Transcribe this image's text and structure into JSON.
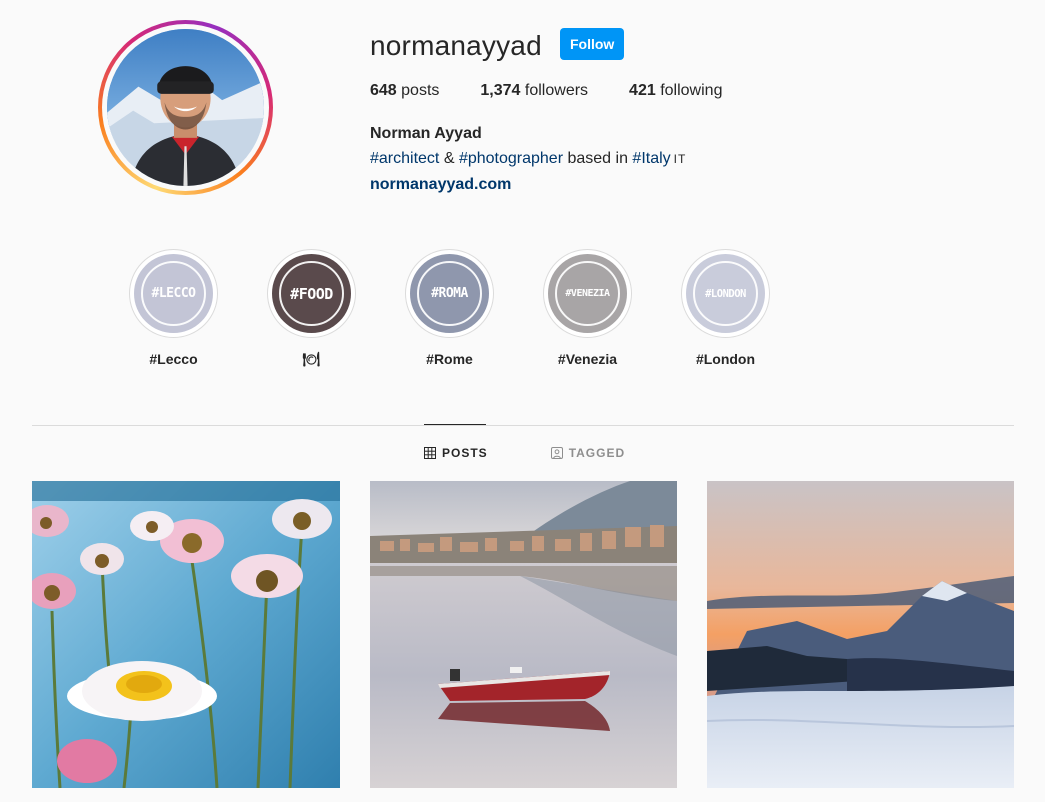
{
  "profile": {
    "username": "normanayyad",
    "follow_label": "Follow",
    "stats": [
      {
        "count": "648",
        "label": "posts"
      },
      {
        "count": "1,374",
        "label": "followers"
      },
      {
        "count": "421",
        "label": "following"
      }
    ],
    "full_name": "Norman Ayyad",
    "bio": {
      "tag1": "#architect",
      "amp": " & ",
      "tag2": "#photographer",
      "mid": " based in ",
      "tag3": "#Italy",
      "flag": "IT"
    },
    "website": "normanayyad.com"
  },
  "highlights": [
    {
      "cover_text": "#LECCO",
      "label": "#Lecco",
      "color": "#c3c5d6"
    },
    {
      "cover_text": "#FOOD",
      "label": "🍽",
      "color": "#5a4a4c"
    },
    {
      "cover_text": "#ROMA",
      "label": "#Rome",
      "color": "#8f97ad"
    },
    {
      "cover_text": "#VENEZIA",
      "label": "#Venezia",
      "color": "#a8a5a6"
    },
    {
      "cover_text": "#LONDON",
      "label": "#London",
      "color": "#c9ccdb"
    }
  ],
  "tabs": {
    "posts": "POSTS",
    "tagged": "TAGGED"
  },
  "colors": {
    "accent": "#0095f6",
    "link": "#00376b",
    "text": "#262626",
    "muted": "#8e8e8e",
    "border": "#dbdbdb",
    "background": "#fafafa"
  },
  "posts": [
    {
      "subject": "daisies-by-lake-photo"
    },
    {
      "subject": "red-boat-on-lake-photo"
    },
    {
      "subject": "snowy-mountain-sunset-photo"
    }
  ]
}
